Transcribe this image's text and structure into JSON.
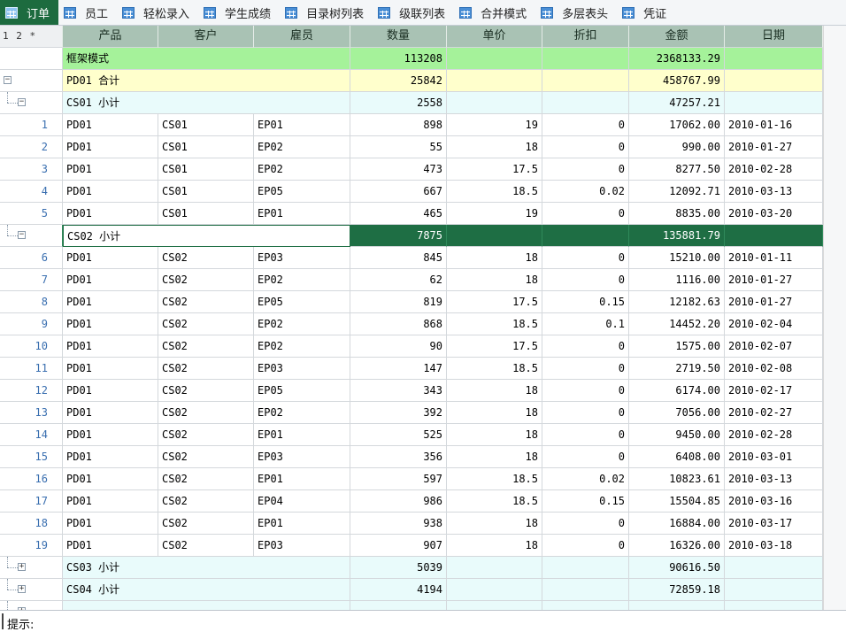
{
  "tabs": [
    {
      "label": "订单",
      "active": true
    },
    {
      "label": "员工"
    },
    {
      "label": "轻松录入"
    },
    {
      "label": "学生成绩"
    },
    {
      "label": "目录树列表"
    },
    {
      "label": "级联列表"
    },
    {
      "label": "合并模式"
    },
    {
      "label": "多层表头"
    },
    {
      "label": "凭证"
    }
  ],
  "grid": {
    "levels_label": "1 2 *",
    "columns": [
      "产品",
      "客户",
      "雇员",
      "数量",
      "单价",
      "折扣",
      "金额",
      "日期"
    ],
    "total_row": {
      "label": "框架模式",
      "qty": "113208",
      "amount": "2368133.29"
    },
    "pd01_row": {
      "label": "PD01 合计",
      "qty": "25842",
      "amount": "458767.99"
    },
    "cs01_row": {
      "label": "CS01 小计",
      "qty": "2558",
      "amount": "47257.21"
    },
    "cs01_items": [
      {
        "n": "1",
        "p": "PD01",
        "c": "CS01",
        "e": "EP01",
        "q": "898",
        "u": "19",
        "d": "0",
        "a": "17062.00",
        "dt": "2010-01-16"
      },
      {
        "n": "2",
        "p": "PD01",
        "c": "CS01",
        "e": "EP02",
        "q": "55",
        "u": "18",
        "d": "0",
        "a": "990.00",
        "dt": "2010-01-27"
      },
      {
        "n": "3",
        "p": "PD01",
        "c": "CS01",
        "e": "EP02",
        "q": "473",
        "u": "17.5",
        "d": "0",
        "a": "8277.50",
        "dt": "2010-02-28"
      },
      {
        "n": "4",
        "p": "PD01",
        "c": "CS01",
        "e": "EP05",
        "q": "667",
        "u": "18.5",
        "d": "0.02",
        "a": "12092.71",
        "dt": "2010-03-13"
      },
      {
        "n": "5",
        "p": "PD01",
        "c": "CS01",
        "e": "EP01",
        "q": "465",
        "u": "19",
        "d": "0",
        "a": "8835.00",
        "dt": "2010-03-20"
      }
    ],
    "cs02_row": {
      "label": "CS02 小计",
      "qty": "7875",
      "amount": "135881.79"
    },
    "cs02_items": [
      {
        "n": "6",
        "p": "PD01",
        "c": "CS02",
        "e": "EP03",
        "q": "845",
        "u": "18",
        "d": "0",
        "a": "15210.00",
        "dt": "2010-01-11"
      },
      {
        "n": "7",
        "p": "PD01",
        "c": "CS02",
        "e": "EP02",
        "q": "62",
        "u": "18",
        "d": "0",
        "a": "1116.00",
        "dt": "2010-01-27"
      },
      {
        "n": "8",
        "p": "PD01",
        "c": "CS02",
        "e": "EP05",
        "q": "819",
        "u": "17.5",
        "d": "0.15",
        "a": "12182.63",
        "dt": "2010-01-27"
      },
      {
        "n": "9",
        "p": "PD01",
        "c": "CS02",
        "e": "EP02",
        "q": "868",
        "u": "18.5",
        "d": "0.1",
        "a": "14452.20",
        "dt": "2010-02-04"
      },
      {
        "n": "10",
        "p": "PD01",
        "c": "CS02",
        "e": "EP02",
        "q": "90",
        "u": "17.5",
        "d": "0",
        "a": "1575.00",
        "dt": "2010-02-07"
      },
      {
        "n": "11",
        "p": "PD01",
        "c": "CS02",
        "e": "EP03",
        "q": "147",
        "u": "18.5",
        "d": "0",
        "a": "2719.50",
        "dt": "2010-02-08"
      },
      {
        "n": "12",
        "p": "PD01",
        "c": "CS02",
        "e": "EP05",
        "q": "343",
        "u": "18",
        "d": "0",
        "a": "6174.00",
        "dt": "2010-02-17"
      },
      {
        "n": "13",
        "p": "PD01",
        "c": "CS02",
        "e": "EP02",
        "q": "392",
        "u": "18",
        "d": "0",
        "a": "7056.00",
        "dt": "2010-02-27"
      },
      {
        "n": "14",
        "p": "PD01",
        "c": "CS02",
        "e": "EP01",
        "q": "525",
        "u": "18",
        "d": "0",
        "a": "9450.00",
        "dt": "2010-02-28"
      },
      {
        "n": "15",
        "p": "PD01",
        "c": "CS02",
        "e": "EP03",
        "q": "356",
        "u": "18",
        "d": "0",
        "a": "6408.00",
        "dt": "2010-03-01"
      },
      {
        "n": "16",
        "p": "PD01",
        "c": "CS02",
        "e": "EP01",
        "q": "597",
        "u": "18.5",
        "d": "0.02",
        "a": "10823.61",
        "dt": "2010-03-13"
      },
      {
        "n": "17",
        "p": "PD01",
        "c": "CS02",
        "e": "EP04",
        "q": "986",
        "u": "18.5",
        "d": "0.15",
        "a": "15504.85",
        "dt": "2010-03-16"
      },
      {
        "n": "18",
        "p": "PD01",
        "c": "CS02",
        "e": "EP01",
        "q": "938",
        "u": "18",
        "d": "0",
        "a": "16884.00",
        "dt": "2010-03-17"
      },
      {
        "n": "19",
        "p": "PD01",
        "c": "CS02",
        "e": "EP03",
        "q": "907",
        "u": "18",
        "d": "0",
        "a": "16326.00",
        "dt": "2010-03-18"
      }
    ],
    "cs03_row": {
      "label": "CS03 小计",
      "qty": "5039",
      "amount": "90616.50"
    },
    "cs04_row": {
      "label": "CS04 小计",
      "qty": "4194",
      "amount": "72859.18"
    }
  },
  "status": {
    "hint_label": "提示:"
  },
  "colors": {
    "selected_row": "#1e6e44",
    "total_row": "#a5f29a",
    "product_row": "#ffffcc",
    "customer_row": "#e9fbfb",
    "header": "#a9c2b4"
  }
}
